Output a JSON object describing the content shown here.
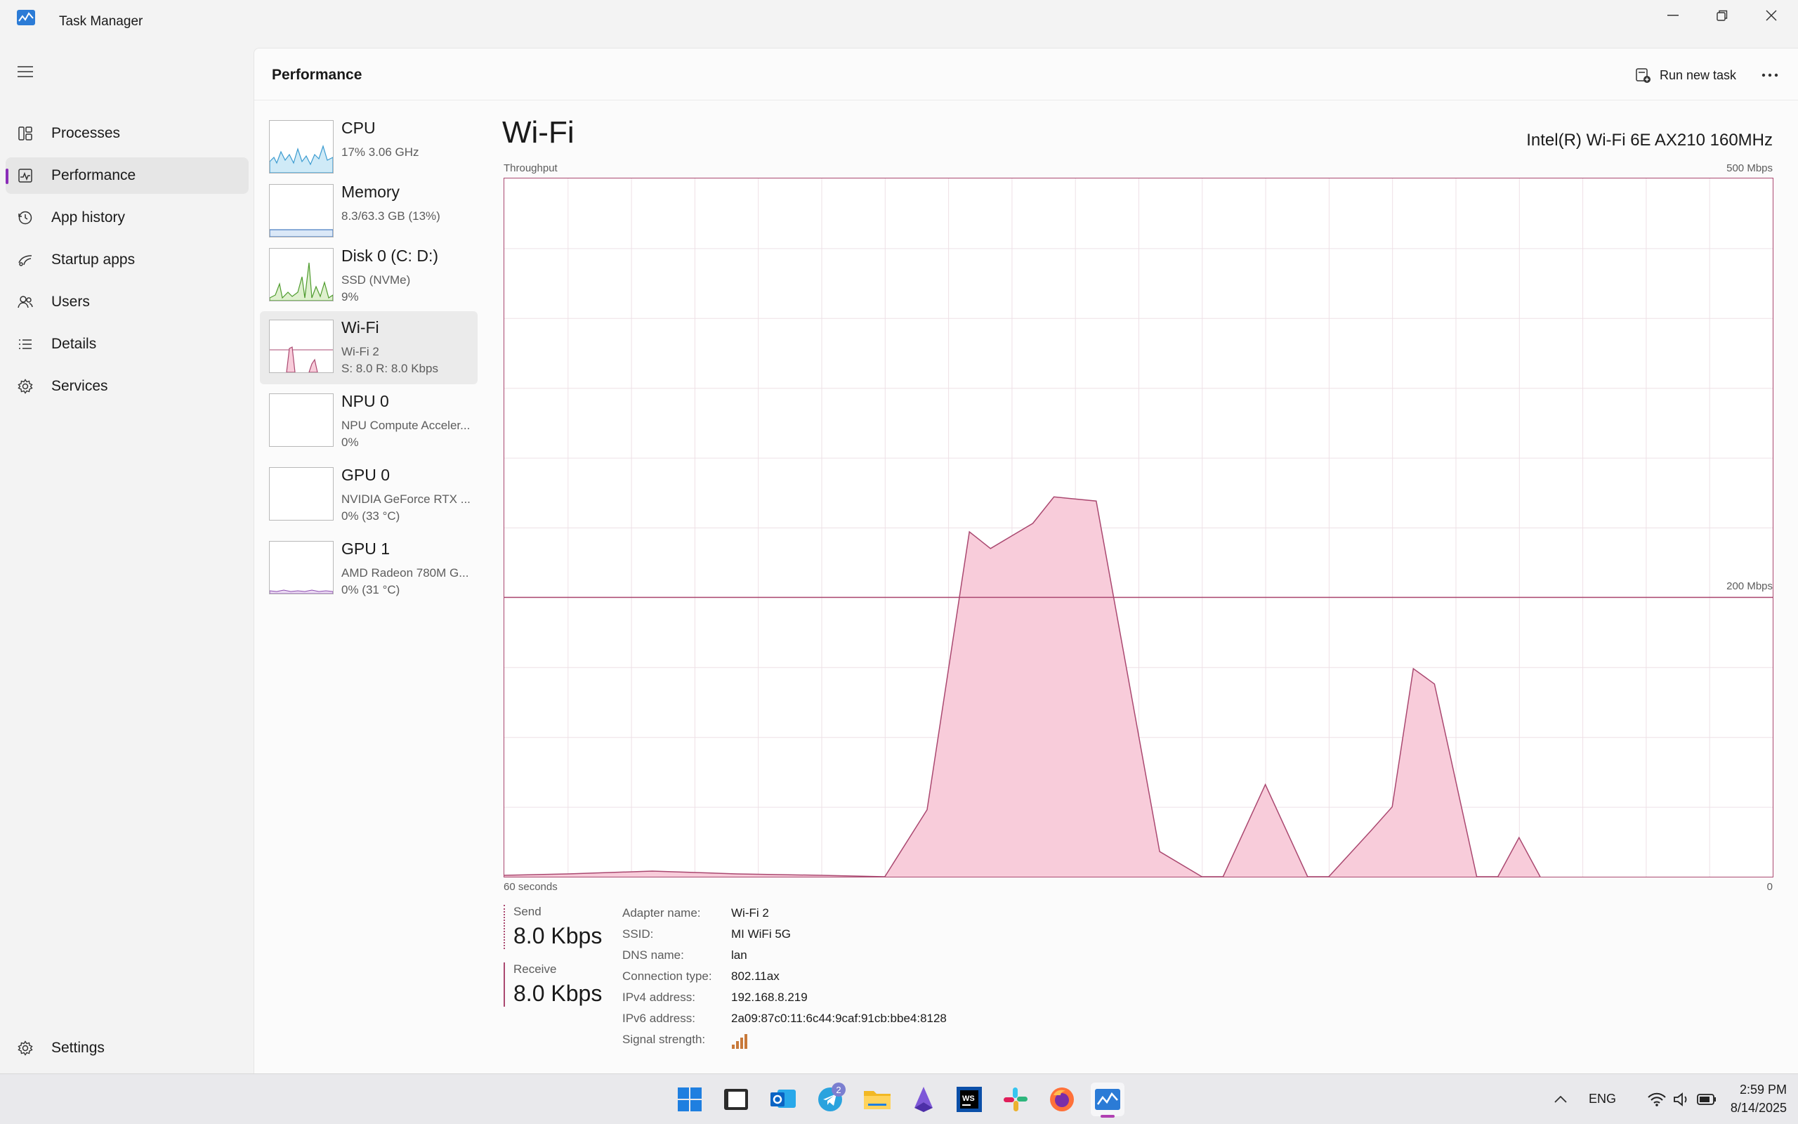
{
  "app": {
    "title": "Task Manager"
  },
  "nav": {
    "items": [
      {
        "label": "Processes",
        "icon": "processes-icon"
      },
      {
        "label": "Performance",
        "icon": "performance-icon"
      },
      {
        "label": "App history",
        "icon": "app-history-icon"
      },
      {
        "label": "Startup apps",
        "icon": "startup-apps-icon"
      },
      {
        "label": "Users",
        "icon": "users-icon"
      },
      {
        "label": "Details",
        "icon": "details-icon"
      },
      {
        "label": "Services",
        "icon": "services-icon"
      }
    ],
    "active": "Performance",
    "settings": "Settings"
  },
  "header": {
    "title": "Performance",
    "run_task": "Run new task"
  },
  "devices": [
    {
      "name": "CPU",
      "lines": [
        "17%  3.06 GHz"
      ]
    },
    {
      "name": "Memory",
      "lines": [
        "8.3/63.3 GB (13%)"
      ]
    },
    {
      "name": "Disk 0 (C: D:)",
      "lines": [
        "SSD (NVMe)",
        "9%"
      ]
    },
    {
      "name": "Wi-Fi",
      "lines": [
        "Wi-Fi 2",
        "S: 8.0  R: 8.0 Kbps"
      ]
    },
    {
      "name": "NPU 0",
      "lines": [
        "NPU Compute Acceler...",
        "0%"
      ]
    },
    {
      "name": "GPU 0",
      "lines": [
        "NVIDIA GeForce RTX ...",
        "0%  (33 °C)"
      ]
    },
    {
      "name": "GPU 1",
      "lines": [
        "AMD Radeon 780M G...",
        "0%  (31 °C)"
      ]
    }
  ],
  "selected_device": "Wi-Fi",
  "main": {
    "title": "Wi-Fi",
    "adapter": "Intel(R) Wi-Fi 6E AX210 160MHz",
    "throughput_label": "Throughput",
    "max_label": "500 Mbps",
    "mid_label": "200 Mbps",
    "time_left": "60 seconds",
    "time_right": "0"
  },
  "stats": {
    "send_label": "Send",
    "send_value": "8.0 Kbps",
    "receive_label": "Receive",
    "receive_value": "8.0 Kbps"
  },
  "properties": [
    {
      "key": "Adapter name:",
      "value": "Wi-Fi 2"
    },
    {
      "key": "SSID:",
      "value": "MI WiFi 5G"
    },
    {
      "key": "DNS name:",
      "value": "lan"
    },
    {
      "key": "Connection type:",
      "value": "802.11ax"
    },
    {
      "key": "IPv4 address:",
      "value": "192.168.8.219"
    },
    {
      "key": "IPv6 address:",
      "value": "2a09:87c0:11:6c44:9caf:91cb:bbe4:8128"
    },
    {
      "key": "Signal strength:",
      "value": ""
    }
  ],
  "chart_data": {
    "type": "area",
    "xlabel": "",
    "ylabel": "Throughput",
    "x_range_seconds": [
      60,
      0
    ],
    "ylim_mbps": [
      0,
      500
    ],
    "scale_line_mbps": 200,
    "grid": true,
    "series": [
      {
        "x_seconds_ago": [
          60,
          57,
          53,
          49,
          45,
          42,
          40,
          38,
          37,
          35,
          34,
          32,
          29,
          27,
          26,
          24,
          22,
          21,
          19,
          18,
          17,
          16,
          14,
          13,
          12,
          11
        ],
        "values_mbps": [
          1,
          2,
          4,
          2,
          1,
          0,
          48,
          247,
          235,
          253,
          272,
          269,
          18,
          0,
          0,
          66,
          0,
          0,
          33,
          50,
          149,
          138,
          0,
          0,
          28,
          0
        ]
      }
    ],
    "colors": {
      "line": "#aa4870",
      "fill": "#f8ccda"
    }
  },
  "taskbar": {
    "apps": [
      "start-icon",
      "terminal-icon",
      "outlook-icon",
      "telegram-icon",
      "file-explorer-icon",
      "app-icon",
      "webstorm-icon",
      "slack-icon",
      "firefox-icon",
      "task-manager-icon"
    ],
    "telegram_badge": "2",
    "lang": "ENG",
    "time": "2:59 PM",
    "date": "8/14/2025"
  }
}
